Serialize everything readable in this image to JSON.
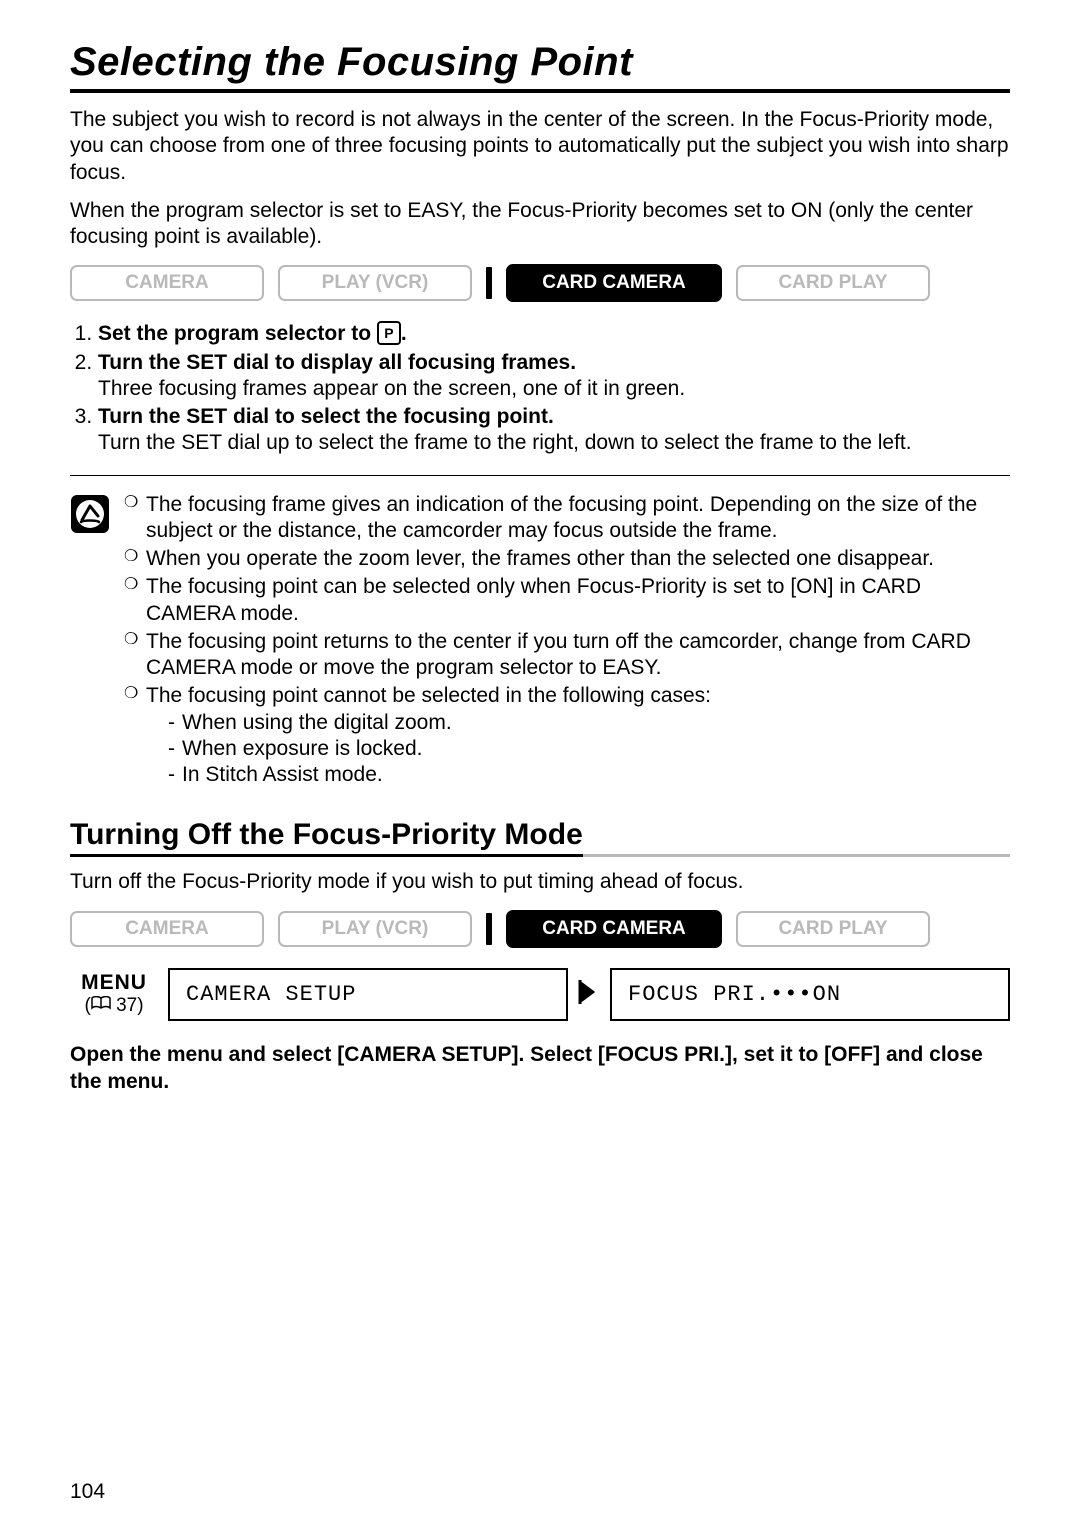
{
  "title": "Selecting the Focusing Point",
  "intro": [
    "The subject you wish to record is not always in the center of the screen. In the Focus-Priority mode, you can choose from one of three focusing points to automatically put the subject you wish into sharp focus.",
    "When the program selector is set to EASY, the Focus-Priority becomes set to ON (only the center focusing point is available)."
  ],
  "modes1": {
    "camera": "CAMERA",
    "play": "PLAY (VCR)",
    "card_camera": "CARD CAMERA",
    "card_play": "CARD PLAY"
  },
  "steps": [
    {
      "head_pre": "Set the program selector to ",
      "head_post": "."
    },
    {
      "head": "Turn the SET dial to display all focusing frames.",
      "desc": "Three focusing frames appear on the screen, one of it in green."
    },
    {
      "head": "Turn the SET dial to select the focusing point.",
      "desc": "Turn the SET dial up to select the frame to the right, down to select the frame to the left."
    }
  ],
  "notes": [
    "The focusing frame gives an indication of the focusing point. Depending on the size of the subject or the distance, the camcorder may focus outside the frame.",
    "When you operate the zoom lever, the frames other than the selected one disappear.",
    "The focusing point can be selected only when Focus-Priority is set to [ON] in CARD CAMERA mode.",
    "The focusing point returns to the center if you turn off the camcorder, change from CARD CAMERA mode or move the program selector to EASY.",
    "The focusing point cannot be selected in the following cases:"
  ],
  "note_sub": [
    "When using the digital zoom.",
    "When exposure is locked.",
    "In Stitch Assist mode."
  ],
  "subhead": "Turning Off the Focus-Priority Mode",
  "sub_intro": "Turn off the Focus-Priority mode if you wish to put timing ahead of focus.",
  "modes2": {
    "camera": "CAMERA",
    "play": "PLAY (VCR)",
    "card_camera": "CARD CAMERA",
    "card_play": "CARD PLAY"
  },
  "menu": {
    "label": "MENU",
    "ref": "37",
    "box1": "CAMERA SETUP",
    "box2": "FOCUS PRI.•••ON"
  },
  "final_instruction": "Open the menu and select [CAMERA SETUP]. Select [FOCUS PRI.], set it to [OFF] and close the menu.",
  "page_number": "104"
}
